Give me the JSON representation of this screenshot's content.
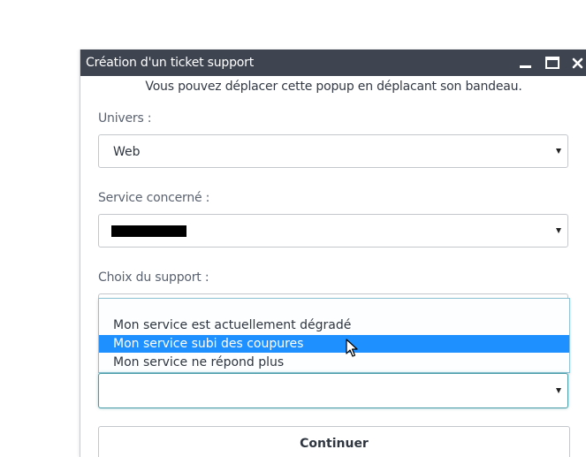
{
  "popup": {
    "title": "Création d'un ticket support",
    "hint": "Vous pouvez déplacer cette popup en déplacant son bandeau.",
    "window_buttons": [
      "minimize-icon",
      "maximize-icon",
      "close-icon"
    ]
  },
  "form": {
    "univers": {
      "label": "Univers :",
      "value": "Web"
    },
    "service": {
      "label": "Service concerné :",
      "value_redacted": true
    },
    "support": {
      "label": "Choix du support :",
      "options": [
        "Mon service est actuellement dégradé",
        "Mon service subi des coupures",
        "Mon service ne répond plus"
      ],
      "highlighted_index": 1
    },
    "continue_label": "Continuer"
  },
  "colors": {
    "titlebar": "#3e4450",
    "highlight": "#1e90ff",
    "focus_border": "#4a9ca6"
  }
}
